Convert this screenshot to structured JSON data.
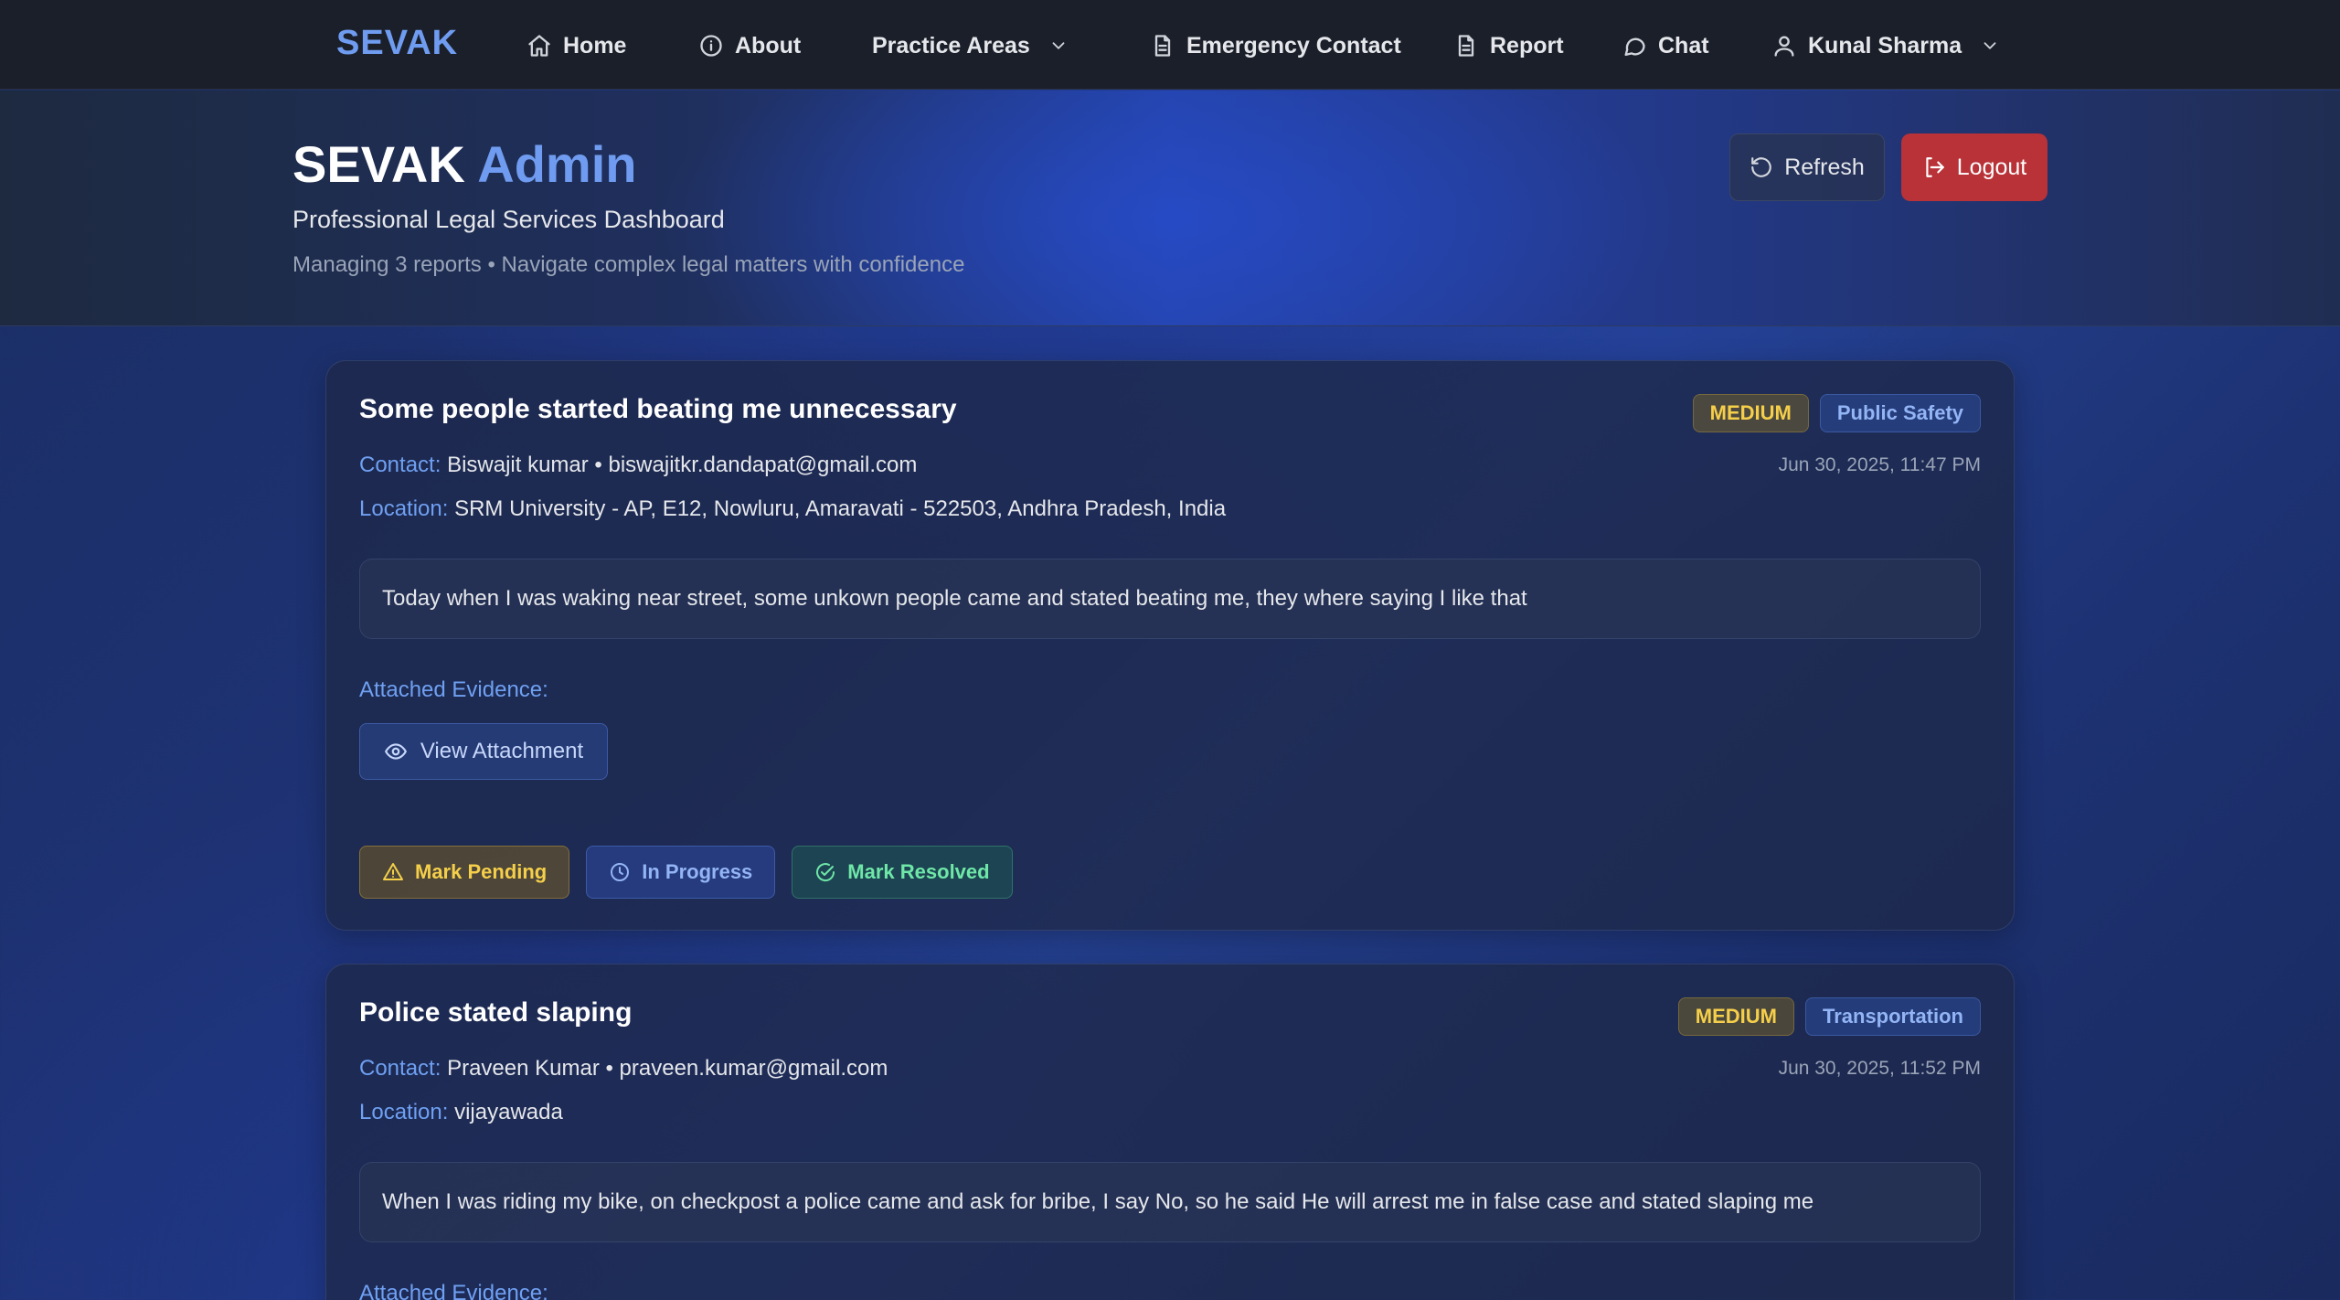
{
  "nav": {
    "brand": "SEVAK",
    "items": [
      {
        "label": "Home",
        "icon": "home-icon"
      },
      {
        "label": "About",
        "icon": "info-icon"
      },
      {
        "label": "Practice Areas",
        "icon": "chevron-down-icon"
      },
      {
        "label": "Emergency Contact",
        "icon": "document-icon"
      },
      {
        "label": "Report",
        "icon": "document-icon"
      },
      {
        "label": "Chat",
        "icon": "chat-bubble-icon"
      },
      {
        "label": "Kunal Sharma",
        "icon": "user-icon"
      }
    ]
  },
  "hero": {
    "title_main": "SEVAK",
    "title_accent": "Admin",
    "subtitle": "Professional Legal Services Dashboard",
    "meta": "Managing 3 reports • Navigate complex legal matters with confidence",
    "refresh_label": "Refresh",
    "logout_label": "Logout"
  },
  "labels": {
    "contact": "Contact:",
    "location": "Location:",
    "evidence": "Attached Evidence:",
    "view_attachment": "View Attachment",
    "mark_pending": "Mark Pending",
    "in_progress": "In Progress",
    "mark_resolved": "Mark Resolved"
  },
  "reports": [
    {
      "title": "Some people started beating me unnecessary",
      "priority": "MEDIUM",
      "category": "Public Safety",
      "contact": "Biswajit kumar • biswajitkr.dandapat@gmail.com",
      "date": "Jun 30, 2025, 11:47 PM",
      "location": "SRM University - AP, E12, Nowluru, Amaravati - 522503, Andhra Pradesh, India",
      "description": "Today when I was waking near street, some unkown people came and stated beating me, they where saying I like that"
    },
    {
      "title": "Police stated slaping",
      "priority": "MEDIUM",
      "category": "Transportation",
      "contact": "Praveen Kumar • praveen.kumar@gmail.com",
      "date": "Jun 30, 2025, 11:52 PM",
      "location": "vijayawada",
      "description": "When I was riding my bike, on checkpost a police came and ask for bribe, I say No, so he said He will arrest me in false case and stated slaping me"
    }
  ],
  "colors": {
    "accent": "#6f9cf0",
    "logout": "#b83238",
    "pending": "#f5cf4a",
    "resolved": "#6ee7a8"
  }
}
